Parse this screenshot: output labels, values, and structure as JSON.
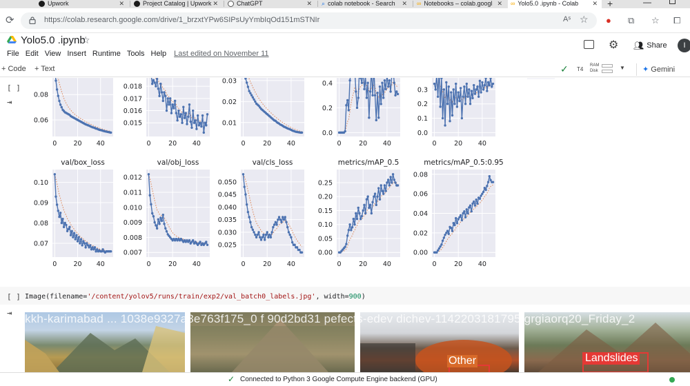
{
  "browser": {
    "tabs": [
      {
        "label": "Upwork",
        "icon": "upwork-icon",
        "active": false
      },
      {
        "label": "Project Catalog | Upwork",
        "icon": "upwork-icon",
        "active": false
      },
      {
        "label": "ChatGPT",
        "icon": "chatgpt-icon",
        "active": false
      },
      {
        "label": "colab notebook - Search",
        "icon": "search-icon",
        "active": false
      },
      {
        "label": "Notebooks – colab.googl",
        "icon": "colab-icon",
        "active": false
      },
      {
        "label": "Yolo5.0 .ipynb - Colab",
        "icon": "colab-icon",
        "active": true
      }
    ],
    "url": "https://colab.research.google.com/drive/1_brzxtYPw6SIPsUyYmbIqOd151mSTNIr"
  },
  "notebook": {
    "title": "Yolo5.0 .ipynb",
    "menu": [
      "File",
      "Edit",
      "View",
      "Insert",
      "Runtime",
      "Tools",
      "Help"
    ],
    "last_edited": "Last edited on November 11",
    "share_label": "Share",
    "avatar_initial": "I"
  },
  "toolbar": {
    "add_code": "+ Code",
    "add_text": "+ Text",
    "runtime_type": "T4",
    "ram_label": "RAM",
    "disk_label": "Disk",
    "gemini_label": "Gemini"
  },
  "cells": {
    "run_bracket": "[ ]",
    "code": {
      "prefix": "Image(filename=",
      "path": "'/content/yolov5/runs/train/exp2/val_batch0_labels.jpg'",
      "mid": ", width=",
      "width_value": "900",
      "suffix": ")"
    },
    "image_overlay_text": "kkh-karimabad ... 1038e9327a8e763f175_0 f 90d2bd31 pefects-edev dichev-1142203181795 grgiaorq20_Friday_2",
    "detection_labels": [
      "Other",
      "Landslides"
    ]
  },
  "status": {
    "text": "Connected to Python 3 Google Compute Engine backend (GPU)"
  },
  "chart_data": [
    {
      "type": "line",
      "title": "",
      "x": [
        0,
        1,
        2,
        3,
        4,
        5,
        6,
        7,
        8,
        9,
        10,
        11,
        12,
        13,
        14,
        15,
        16,
        17,
        18,
        19,
        20,
        21,
        22,
        23,
        24,
        25,
        26,
        27,
        28,
        29,
        30,
        31,
        32,
        33,
        34,
        35,
        36,
        37,
        38,
        39,
        40,
        41,
        42,
        43,
        44,
        45,
        46,
        47,
        48,
        49
      ],
      "y": [
        0.101,
        0.091,
        0.084,
        0.079,
        0.075,
        0.072,
        0.07,
        0.068,
        0.067,
        0.066,
        0.0655,
        0.065,
        0.0645,
        0.064,
        0.063,
        0.0625,
        0.062,
        0.0615,
        0.061,
        0.0605,
        0.06,
        0.0595,
        0.059,
        0.0585,
        0.058,
        0.0575,
        0.057,
        0.0565,
        0.0562,
        0.0558,
        0.0555,
        0.055,
        0.0546,
        0.0542,
        0.054,
        0.0536,
        0.0532,
        0.053,
        0.0526,
        0.0522,
        0.052,
        0.0518,
        0.0515,
        0.0512,
        0.051,
        0.0508,
        0.0506,
        0.0504,
        0.0502,
        0.05
      ],
      "yticks": [
        "0.06",
        "0.08"
      ],
      "xticks": [
        "0",
        "20",
        "40"
      ]
    },
    {
      "type": "line",
      "title": "",
      "x": [
        0,
        1,
        2,
        3,
        4,
        5,
        6,
        7,
        8,
        9,
        10,
        11,
        12,
        13,
        14,
        15,
        16,
        17,
        18,
        19,
        20,
        21,
        22,
        23,
        24,
        25,
        26,
        27,
        28,
        29,
        30,
        31,
        32,
        33,
        34,
        35,
        36,
        37,
        38,
        39,
        40,
        41,
        42,
        43,
        44,
        45,
        46,
        47,
        48,
        49
      ],
      "y": [
        0.0195,
        0.0188,
        0.019,
        0.0182,
        0.0185,
        0.0183,
        0.018,
        0.0186,
        0.0178,
        0.0172,
        0.0182,
        0.0175,
        0.0168,
        0.0175,
        0.0172,
        0.016,
        0.017,
        0.0165,
        0.017,
        0.0158,
        0.0165,
        0.0162,
        0.0168,
        0.0158,
        0.0152,
        0.016,
        0.0155,
        0.0157,
        0.015,
        0.0163,
        0.0154,
        0.0158,
        0.0149,
        0.0155,
        0.0165,
        0.0151,
        0.0146,
        0.016,
        0.015,
        0.0152,
        0.0145,
        0.0156,
        0.0148,
        0.015,
        0.0147,
        0.0156,
        0.0142,
        0.015,
        0.0148,
        0.0157
      ],
      "yticks": [
        "0.015",
        "0.016",
        "0.017",
        "0.018"
      ],
      "xticks": [
        "0",
        "20",
        "40"
      ]
    },
    {
      "type": "line",
      "title": "",
      "x": [
        0,
        1,
        2,
        3,
        4,
        5,
        6,
        7,
        8,
        9,
        10,
        11,
        12,
        13,
        14,
        15,
        16,
        17,
        18,
        19,
        20,
        21,
        22,
        23,
        24,
        25,
        26,
        27,
        28,
        29,
        30,
        31,
        32,
        33,
        34,
        35,
        36,
        37,
        38,
        39,
        40,
        41,
        42,
        43,
        44,
        45,
        46,
        47,
        48,
        49
      ],
      "y": [
        0.036,
        0.034,
        0.031,
        0.029,
        0.027,
        0.025,
        0.024,
        0.023,
        0.022,
        0.021,
        0.02,
        0.019,
        0.0185,
        0.018,
        0.0172,
        0.0165,
        0.016,
        0.0155,
        0.015,
        0.0145,
        0.014,
        0.0135,
        0.013,
        0.0125,
        0.012,
        0.0115,
        0.011,
        0.0108,
        0.0102,
        0.0098,
        0.0095,
        0.009,
        0.0088,
        0.0084,
        0.008,
        0.0078,
        0.0075,
        0.0072,
        0.007,
        0.0068,
        0.0065,
        0.0062,
        0.006,
        0.0058,
        0.0056,
        0.0055,
        0.0054,
        0.0053,
        0.0052,
        0.0052
      ],
      "yticks": [
        "0.01",
        "0.02",
        "0.03"
      ],
      "xticks": [
        "0",
        "20",
        "40"
      ]
    },
    {
      "type": "line",
      "title": "",
      "x": [
        0,
        1,
        2,
        3,
        4,
        5,
        6,
        7,
        8,
        9,
        10,
        11,
        12,
        13,
        14,
        15,
        16,
        17,
        18,
        19,
        20,
        21,
        22,
        23,
        24,
        25,
        26,
        27,
        28,
        29,
        30,
        31,
        32,
        33,
        34,
        35,
        36,
        37,
        38,
        39,
        40,
        41,
        42,
        43,
        44,
        45,
        46,
        47,
        48,
        49
      ],
      "y": [
        0.0,
        0.0,
        0.0,
        0.0,
        0.0,
        0.01,
        0.22,
        0.26,
        0.18,
        0.42,
        0.5,
        0.48,
        0.46,
        0.52,
        0.33,
        0.2,
        0.28,
        0.52,
        0.44,
        0.4,
        0.5,
        0.35,
        0.45,
        0.28,
        0.4,
        0.12,
        0.33,
        0.5,
        0.3,
        0.52,
        0.3,
        0.1,
        0.32,
        0.12,
        0.37,
        0.23,
        0.4,
        0.28,
        0.42,
        0.35,
        0.46,
        0.37,
        0.42,
        0.33,
        0.46,
        0.52,
        0.4,
        0.3,
        0.33,
        0.31
      ],
      "yticks": [
        "0.0",
        "0.2",
        "0.4"
      ],
      "xticks": [
        "0",
        "20",
        "40"
      ]
    },
    {
      "type": "line",
      "title": "",
      "x": [
        0,
        1,
        2,
        3,
        4,
        5,
        6,
        7,
        8,
        9,
        10,
        11,
        12,
        13,
        14,
        15,
        16,
        17,
        18,
        19,
        20,
        21,
        22,
        23,
        24,
        25,
        26,
        27,
        28,
        29,
        30,
        31,
        32,
        33,
        34,
        35,
        36,
        37,
        38,
        39,
        40,
        41,
        42,
        43,
        44,
        45,
        46,
        47,
        48,
        49
      ],
      "y": [
        0.34,
        0.3,
        0.4,
        0.25,
        0.45,
        0.18,
        0.38,
        0.1,
        0.3,
        0.05,
        0.35,
        0.2,
        0.32,
        0.08,
        0.28,
        0.12,
        0.3,
        0.2,
        0.34,
        0.18,
        0.28,
        0.22,
        0.31,
        0.1,
        0.25,
        0.32,
        0.2,
        0.34,
        0.25,
        0.3,
        0.2,
        0.29,
        0.24,
        0.33,
        0.27,
        0.3,
        0.32,
        0.25,
        0.36,
        0.28,
        0.35,
        0.3,
        0.33,
        0.38,
        0.29,
        0.35,
        0.33,
        0.38,
        0.32,
        0.34
      ],
      "yticks": [
        "0.0",
        "0.1",
        "0.2",
        "0.3",
        "0.4"
      ],
      "xticks": [
        "0",
        "20",
        "40"
      ]
    },
    {
      "type": "line",
      "title": "val/box_loss",
      "x": [
        0,
        1,
        2,
        3,
        4,
        5,
        6,
        7,
        8,
        9,
        10,
        11,
        12,
        13,
        14,
        15,
        16,
        17,
        18,
        19,
        20,
        21,
        22,
        23,
        24,
        25,
        26,
        27,
        28,
        29,
        30,
        31,
        32,
        33,
        34,
        35,
        36,
        37,
        38,
        39,
        40,
        41,
        42,
        43,
        44,
        45,
        46,
        47,
        48,
        49
      ],
      "y": [
        0.104,
        0.093,
        0.089,
        0.086,
        0.083,
        0.085,
        0.08,
        0.082,
        0.078,
        0.08,
        0.079,
        0.076,
        0.077,
        0.078,
        0.074,
        0.076,
        0.073,
        0.075,
        0.072,
        0.074,
        0.071,
        0.073,
        0.07,
        0.072,
        0.069,
        0.071,
        0.07,
        0.068,
        0.07,
        0.069,
        0.068,
        0.069,
        0.067,
        0.068,
        0.067,
        0.068,
        0.066,
        0.067,
        0.066,
        0.0665,
        0.066,
        0.066,
        0.067,
        0.066,
        0.0655,
        0.066,
        0.066,
        0.066,
        0.066,
        0.066
      ],
      "yticks": [
        "0.07",
        "0.08",
        "0.09",
        "0.10"
      ],
      "xticks": [
        "0",
        "20",
        "40"
      ]
    },
    {
      "type": "line",
      "title": "val/obj_loss",
      "x": [
        0,
        1,
        2,
        3,
        4,
        5,
        6,
        7,
        8,
        9,
        10,
        11,
        12,
        13,
        14,
        15,
        16,
        17,
        18,
        19,
        20,
        21,
        22,
        23,
        24,
        25,
        26,
        27,
        28,
        29,
        30,
        31,
        32,
        33,
        34,
        35,
        36,
        37,
        38,
        39,
        40,
        41,
        42,
        43,
        44,
        45,
        46,
        47,
        48,
        49
      ],
      "y": [
        0.0122,
        0.0108,
        0.0102,
        0.0096,
        0.0094,
        0.009,
        0.0088,
        0.0086,
        0.0092,
        0.0089,
        0.0093,
        0.0091,
        0.0095,
        0.0089,
        0.0086,
        0.0084,
        0.0082,
        0.0081,
        0.008,
        0.0079,
        0.0078,
        0.0079,
        0.0078,
        0.0079,
        0.0078,
        0.0079,
        0.0078,
        0.0079,
        0.0078,
        0.0077,
        0.0078,
        0.0077,
        0.0078,
        0.0077,
        0.0078,
        0.0076,
        0.0077,
        0.0078,
        0.0076,
        0.0077,
        0.0076,
        0.0075,
        0.0076,
        0.0077,
        0.0075,
        0.0076,
        0.0075,
        0.0076,
        0.0077,
        0.0075
      ],
      "yticks": [
        "0.007",
        "0.008",
        "0.009",
        "0.010",
        "0.011",
        "0.012"
      ],
      "xticks": [
        "0",
        "20",
        "40"
      ]
    },
    {
      "type": "line",
      "title": "val/cls_loss",
      "x": [
        0,
        1,
        2,
        3,
        4,
        5,
        6,
        7,
        8,
        9,
        10,
        11,
        12,
        13,
        14,
        15,
        16,
        17,
        18,
        19,
        20,
        21,
        22,
        23,
        24,
        25,
        26,
        27,
        28,
        29,
        30,
        31,
        32,
        33,
        34,
        35,
        36,
        37,
        38,
        39,
        40,
        41,
        42,
        43,
        44,
        45,
        46,
        47,
        48,
        49
      ],
      "y": [
        0.053,
        0.048,
        0.045,
        0.041,
        0.038,
        0.036,
        0.034,
        0.032,
        0.031,
        0.03,
        0.029,
        0.028,
        0.029,
        0.03,
        0.028,
        0.027,
        0.028,
        0.029,
        0.027,
        0.029,
        0.03,
        0.028,
        0.029,
        0.028,
        0.03,
        0.032,
        0.033,
        0.034,
        0.033,
        0.035,
        0.036,
        0.035,
        0.034,
        0.036,
        0.035,
        0.036,
        0.034,
        0.032,
        0.03,
        0.029,
        0.028,
        0.026,
        0.025,
        0.025,
        0.024,
        0.024,
        0.023,
        0.023,
        0.022,
        0.022
      ],
      "yticks": [
        "0.025",
        "0.030",
        "0.035",
        "0.040",
        "0.045",
        "0.050"
      ],
      "xticks": [
        "0",
        "20",
        "40"
      ]
    },
    {
      "type": "line",
      "title": "metrics/mAP_0.5",
      "x": [
        0,
        1,
        2,
        3,
        4,
        5,
        6,
        7,
        8,
        9,
        10,
        11,
        12,
        13,
        14,
        15,
        16,
        17,
        18,
        19,
        20,
        21,
        22,
        23,
        24,
        25,
        26,
        27,
        28,
        29,
        30,
        31,
        32,
        33,
        34,
        35,
        36,
        37,
        38,
        39,
        40,
        41,
        42,
        43,
        44,
        45,
        46,
        47,
        48,
        49
      ],
      "y": [
        0.0,
        0.0,
        0.005,
        0.01,
        0.015,
        0.02,
        0.03,
        0.06,
        0.08,
        0.1,
        0.08,
        0.09,
        0.12,
        0.1,
        0.14,
        0.12,
        0.16,
        0.14,
        0.12,
        0.13,
        0.15,
        0.17,
        0.14,
        0.19,
        0.2,
        0.16,
        0.17,
        0.14,
        0.18,
        0.2,
        0.21,
        0.17,
        0.2,
        0.23,
        0.19,
        0.24,
        0.22,
        0.21,
        0.24,
        0.22,
        0.25,
        0.26,
        0.24,
        0.27,
        0.25,
        0.28,
        0.26,
        0.25,
        0.24,
        0.24
      ],
      "yticks": [
        "0.00",
        "0.05",
        "0.10",
        "0.15",
        "0.20",
        "0.25"
      ],
      "xticks": [
        "0",
        "20",
        "40"
      ]
    },
    {
      "type": "line",
      "title": "metrics/mAP_0.5:0.95",
      "x": [
        0,
        1,
        2,
        3,
        4,
        5,
        6,
        7,
        8,
        9,
        10,
        11,
        12,
        13,
        14,
        15,
        16,
        17,
        18,
        19,
        20,
        21,
        22,
        23,
        24,
        25,
        26,
        27,
        28,
        29,
        30,
        31,
        32,
        33,
        34,
        35,
        36,
        37,
        38,
        39,
        40,
        41,
        42,
        43,
        44,
        45,
        46,
        47,
        48,
        49
      ],
      "y": [
        0.0,
        0.0,
        0.0,
        0.002,
        0.004,
        0.006,
        0.008,
        0.012,
        0.015,
        0.018,
        0.02,
        0.022,
        0.019,
        0.026,
        0.025,
        0.022,
        0.03,
        0.028,
        0.035,
        0.03,
        0.034,
        0.036,
        0.038,
        0.033,
        0.04,
        0.042,
        0.036,
        0.044,
        0.04,
        0.046,
        0.048,
        0.042,
        0.05,
        0.052,
        0.048,
        0.054,
        0.05,
        0.056,
        0.055,
        0.058,
        0.06,
        0.062,
        0.066,
        0.064,
        0.068,
        0.072,
        0.078,
        0.074,
        0.072,
        0.072
      ],
      "yticks": [
        "0.00",
        "0.02",
        "0.04",
        "0.06",
        "0.08"
      ],
      "xticks": [
        "0",
        "20",
        "40"
      ]
    }
  ],
  "colors": {
    "plot_bg": "#eaeaf2",
    "series": "#4c72b0",
    "smooth": "#dd8452"
  }
}
